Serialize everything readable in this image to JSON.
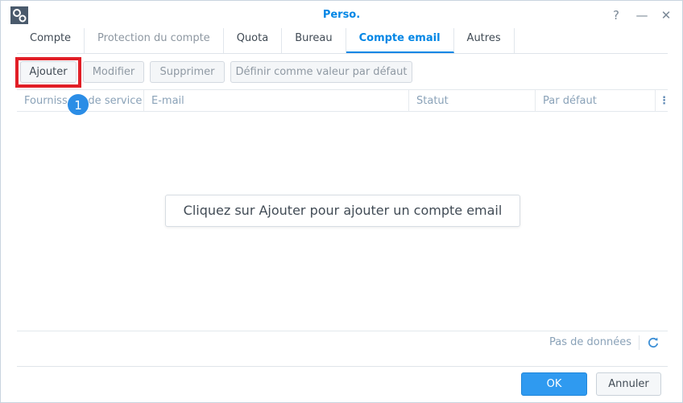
{
  "window": {
    "title": "Perso.",
    "help_label": "?",
    "minimize_label": "—",
    "close_label": "✕"
  },
  "tabs": [
    {
      "label": "Compte",
      "state": "normal"
    },
    {
      "label": "Protection du compte",
      "state": "disabled"
    },
    {
      "label": "Quota",
      "state": "normal"
    },
    {
      "label": "Bureau",
      "state": "normal"
    },
    {
      "label": "Compte email",
      "state": "active"
    },
    {
      "label": "Autres",
      "state": "normal"
    }
  ],
  "toolbar": {
    "add_label": "Ajouter",
    "modify_label": "Modifier",
    "delete_label": "Supprimer",
    "set_default_label": "Définir comme valeur par défaut"
  },
  "annotation": {
    "step_number": "1",
    "highlight_color": "#e11e26"
  },
  "grid": {
    "columns": [
      "Fournisseur de service",
      "E-mail",
      "Statut",
      "Par défaut"
    ],
    "menu_label": "⋮",
    "rows": [],
    "empty_message": "Cliquez sur Ajouter pour ajouter un compte email"
  },
  "paging": {
    "status_text": "Pas de données"
  },
  "footer": {
    "ok_label": "OK",
    "cancel_label": "Annuler"
  },
  "colors": {
    "accent": "#0086e5",
    "primary_button": "#2f9af0"
  }
}
